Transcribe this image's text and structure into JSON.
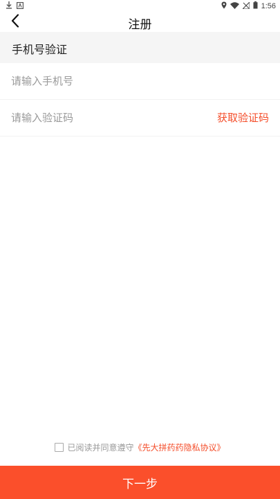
{
  "status_bar": {
    "time": "1:56",
    "left_icons": [
      "download-icon",
      "notification-icon"
    ],
    "right_icons": [
      "location-icon",
      "wifi-icon",
      "signal-icon",
      "battery-icon"
    ]
  },
  "nav": {
    "back_icon": "chevron-left-icon",
    "title": "注册"
  },
  "section": {
    "title": "手机号验证"
  },
  "form": {
    "phone_value": "",
    "phone_placeholder": "请输入手机号",
    "code_value": "",
    "code_placeholder": "请输入验证码",
    "get_code_label": "获取验证码"
  },
  "agreement": {
    "checked": false,
    "text": "已阅读并同意遵守",
    "link": "《先大拼药药隐私协议》"
  },
  "next_button": {
    "label": "下一步"
  },
  "colors": {
    "accent": "#fb4f2b",
    "link": "#f44d2a",
    "section_bg": "#f5f5f5",
    "placeholder": "#9a9a9a"
  }
}
